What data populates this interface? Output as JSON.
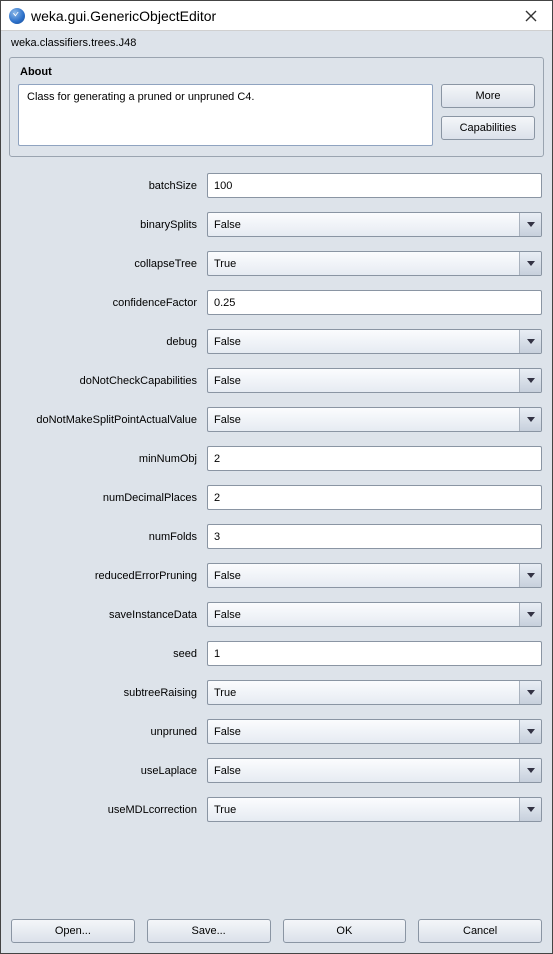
{
  "window": {
    "title": "weka.gui.GenericObjectEditor"
  },
  "classpath": "weka.classifiers.trees.J48",
  "about": {
    "heading": "About",
    "text": "Class for generating a pruned or unpruned C4.",
    "more_label": "More",
    "capabilities_label": "Capabilities"
  },
  "params": [
    {
      "name": "batchSize",
      "type": "text",
      "value": "100"
    },
    {
      "name": "binarySplits",
      "type": "combo",
      "value": "False"
    },
    {
      "name": "collapseTree",
      "type": "combo",
      "value": "True"
    },
    {
      "name": "confidenceFactor",
      "type": "text",
      "value": "0.25"
    },
    {
      "name": "debug",
      "type": "combo",
      "value": "False"
    },
    {
      "name": "doNotCheckCapabilities",
      "type": "combo",
      "value": "False"
    },
    {
      "name": "doNotMakeSplitPointActualValue",
      "type": "combo",
      "value": "False"
    },
    {
      "name": "minNumObj",
      "type": "text",
      "value": "2"
    },
    {
      "name": "numDecimalPlaces",
      "type": "text",
      "value": "2"
    },
    {
      "name": "numFolds",
      "type": "text",
      "value": "3"
    },
    {
      "name": "reducedErrorPruning",
      "type": "combo",
      "value": "False"
    },
    {
      "name": "saveInstanceData",
      "type": "combo",
      "value": "False"
    },
    {
      "name": "seed",
      "type": "text",
      "value": "1"
    },
    {
      "name": "subtreeRaising",
      "type": "combo",
      "value": "True"
    },
    {
      "name": "unpruned",
      "type": "combo",
      "value": "False"
    },
    {
      "name": "useLaplace",
      "type": "combo",
      "value": "False"
    },
    {
      "name": "useMDLcorrection",
      "type": "combo",
      "value": "True"
    }
  ],
  "buttons": {
    "open": "Open...",
    "save": "Save...",
    "ok": "OK",
    "cancel": "Cancel"
  }
}
